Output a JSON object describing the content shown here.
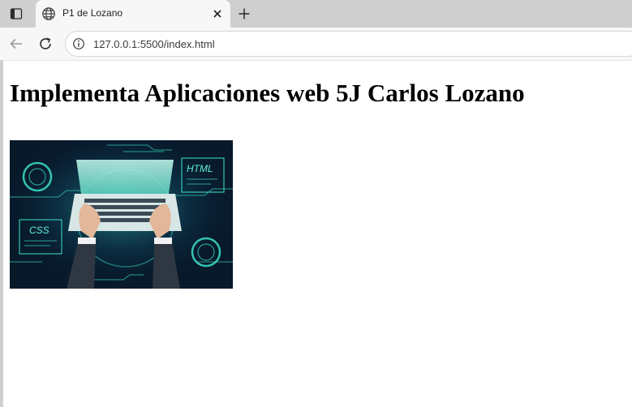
{
  "browser": {
    "tab": {
      "title": "P1 de Lozano"
    },
    "address_bar": {
      "url": "127.0.0.1:5500/index.html"
    },
    "icons": [
      "sidebar-toggle-icon",
      "globe-icon",
      "close-icon",
      "plus-icon",
      "back-arrow-icon",
      "reload-icon",
      "info-icon"
    ]
  },
  "page": {
    "heading": "Implementa Aplicaciones web 5J Carlos Lozano",
    "image": {
      "labels": {
        "html": "HTML",
        "css": "CSS"
      }
    }
  }
}
